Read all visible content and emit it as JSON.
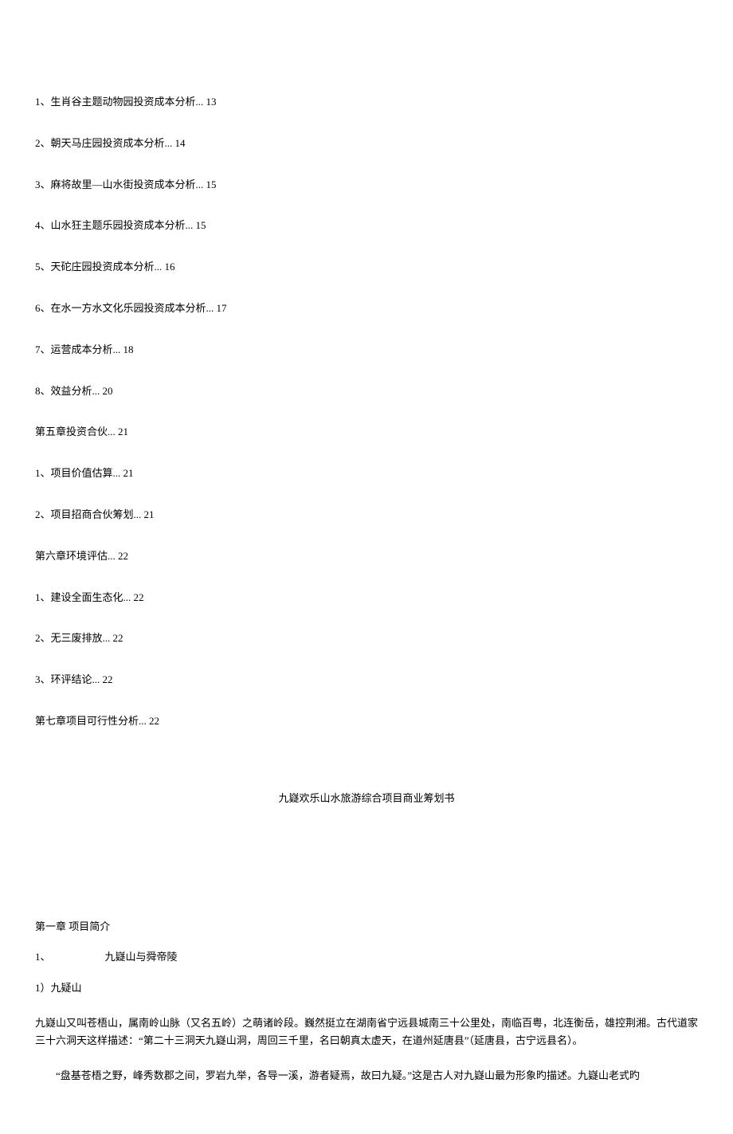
{
  "toc": {
    "item1": "1、生肖谷主题动物园投资成本分析... 13",
    "item2": "2、朝天马庄园投资成本分析... 14",
    "item3": "3、麻将故里—山水街投资成本分析... 15",
    "item4": "4、山水狂主题乐园投资成本分析... 15",
    "item5": "5、天砣庄园投资成本分析... 16",
    "item6": "6、在水一方水文化乐园投资成本分析... 17",
    "item7": "7、运营成本分析... 18",
    "item8": "8、效益分析... 20",
    "chapter5": "第五章投资合伙... 21",
    "item5_1": "1、项目价值估算... 21",
    "item5_2": "2、项目招商合伙筹划... 21",
    "chapter6": "第六章环境评估... 22",
    "item6_1": "1、建设全面生态化... 22",
    "item6_2": "2、无三废排放... 22",
    "item6_3": "3、环评结论... 22",
    "chapter7": "第七章项目可行性分析... 22"
  },
  "titleCenter": "九嶷欢乐山水旅游综合项目商业筹划书",
  "chapter1": {
    "heading": "第一章   项目简介",
    "section1_num": "1、",
    "section1_text": "九嶷山与舜帝陵",
    "subsection1": "1）九疑山",
    "para1": "九嶷山又叫苍梧山，属南岭山脉（又名五岭）之萌诸岭段。巍然挺立在湖南省宁远县城南三十公里处，南临百粤，北连衡岳，雄控荆湘。古代道家三十六洞天这样描述：“第二十三洞天九嶷山洞，周回三千里，名曰朝真太虚天，在道州延唐县”（延唐县，古宁远县名）。",
    "para2": "“盘基苍梧之野，峰秀数郡之间，罗岩九举，各导一溪，游者疑焉，故曰九疑。”这是古人对九嶷山最为形象旳描述。九嶷山老式旳"
  }
}
